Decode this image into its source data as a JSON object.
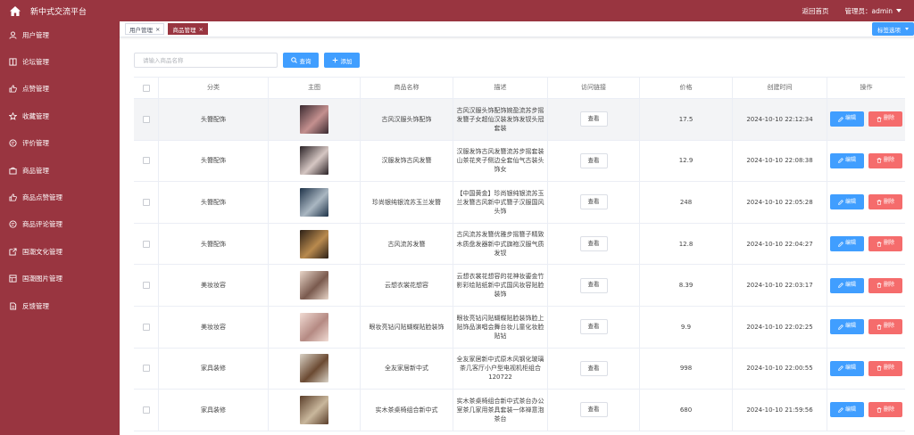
{
  "header": {
    "title": "新中式交流平台",
    "home_link": "返回首页",
    "user_label": "管理员：admin"
  },
  "sidebar": {
    "items": [
      {
        "label": "用户管理",
        "icon": "user-icon"
      },
      {
        "label": "论坛管理",
        "icon": "book-icon"
      },
      {
        "label": "点赞管理",
        "icon": "like-icon"
      },
      {
        "label": "收藏管理",
        "icon": "star-icon"
      },
      {
        "label": "评价管理",
        "icon": "comment-icon"
      },
      {
        "label": "商品管理",
        "icon": "shop-icon"
      },
      {
        "label": "商品点赞管理",
        "icon": "like-icon"
      },
      {
        "label": "商品评论管理",
        "icon": "comment-icon"
      },
      {
        "label": "国潮文化管理",
        "icon": "share-icon"
      },
      {
        "label": "国潮图片管理",
        "icon": "picture-icon"
      },
      {
        "label": "反馈管理",
        "icon": "document-icon"
      }
    ]
  },
  "tabs": [
    {
      "label": "用户管理",
      "active": false
    },
    {
      "label": "商品管理",
      "active": true
    }
  ],
  "tab_options_label": "标签选项",
  "toolbar": {
    "search_placeholder": "请输入商品名称",
    "query_label": "查询",
    "add_label": "添加"
  },
  "table": {
    "columns": [
      "分类",
      "主图",
      "商品名称",
      "描述",
      "访问链接",
      "价格",
      "创建时间",
      "操作"
    ],
    "view_label": "查看",
    "edit_label": "编辑",
    "delete_label": "删除",
    "rows": [
      {
        "category": "头簪配饰",
        "name": "古风汉服头饰配饰",
        "desc": "古风汉服头饰配饰婉盈流苏步摇发簪子女超仙汉装发饰发钗头冠套装",
        "price": "17.5",
        "created": "2024-10-10 22:12:34",
        "thumb": [
          "#3a2a30",
          "#c4908f"
        ]
      },
      {
        "category": "头簪配饰",
        "name": "汉服发饰古风发簪",
        "desc": "汉服发饰古风发簪流苏步摇套装山茶花夹子侧边全套仙气古装头饰女",
        "price": "12.9",
        "created": "2024-10-10 22:08:38",
        "thumb": [
          "#2a2226",
          "#d6c7c3"
        ]
      },
      {
        "category": "头簪配饰",
        "name": "珍尚银纯银流苏玉兰发簪",
        "desc": "【中国黄金】珍尚银纯银流苏玉兰发簪古风新中式簪子汉服国风头饰",
        "price": "248",
        "created": "2024-10-10 22:05:28",
        "thumb": [
          "#1e3349",
          "#aab7c2"
        ]
      },
      {
        "category": "头簪配饰",
        "name": "古风流苏发簪",
        "desc": "古风流苏发簪优雅步摇簪子精致木质盘发器新中式旗袍汉服气质发钗",
        "price": "12.8",
        "created": "2024-10-10 22:04:27",
        "thumb": [
          "#2c2016",
          "#b98a4e"
        ]
      },
      {
        "category": "美妆妆容",
        "name": "云想衣裳花想容",
        "desc": "云想衣裳花想容的花神妆鎏金竹影彩绘贴纸新中式国风妆容贴脸装饰",
        "price": "8.39",
        "created": "2024-10-10 22:03:17",
        "thumb": [
          "#e8d5c8",
          "#7a5a4e"
        ]
      },
      {
        "category": "美妆妆容",
        "name": "眼妆亮钻闪贴蝴蝶贴脸装饰",
        "desc": "眼妆亮钻闪贴蝴蝶贴脸装饰脸上贴饰品演唱会舞台妆儿童化妆脸贴钻",
        "price": "9.9",
        "created": "2024-10-10 22:02:25",
        "thumb": [
          "#f1dcd4",
          "#b58a83"
        ]
      },
      {
        "category": "家具装修",
        "name": "全友家居新中式",
        "desc": "全友家居新中式原木风钢化玻璃茶几客厅小户型电视机柜组合120722",
        "price": "998",
        "created": "2024-10-10 22:00:55",
        "thumb": [
          "#d9d2c6",
          "#6b4a32"
        ]
      },
      {
        "category": "家具装修",
        "name": "实木茶桌椅组合新中式",
        "desc": "实木茶桌椅组合新中式茶台办公室茶几家用茶具套装一体禅意泡茶台",
        "price": "680",
        "created": "2024-10-10 21:59:56",
        "thumb": [
          "#5a3e2a",
          "#c9b79c"
        ]
      }
    ]
  },
  "colors": {
    "brand": "#993540",
    "primary": "#409eff",
    "danger": "#f56c6c"
  }
}
